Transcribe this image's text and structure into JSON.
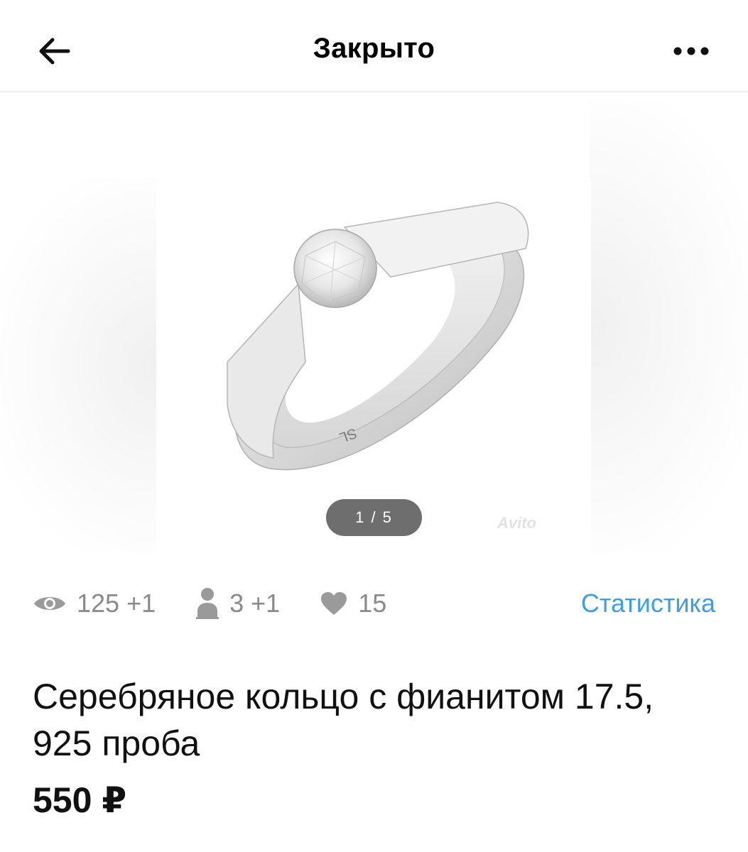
{
  "header": {
    "title": "Закрыто"
  },
  "gallery": {
    "counter": "1 / 5",
    "watermark": "Avito",
    "ring_marking": "SL"
  },
  "stats": {
    "views": "125 +1",
    "contacts": "3 +1",
    "favorites": "15",
    "link": "Статистика"
  },
  "listing": {
    "title": "Серебряное кольцо с фианитом 17.5, 925 проба",
    "price": "550 ₽"
  },
  "colors": {
    "accent": "#3d9ee8",
    "muted": "#8a8a8a",
    "counter_bg": "#6e6e6e"
  },
  "icons": {
    "back": "arrow-left-icon",
    "more": "more-horizontal-icon",
    "views": "eye-icon",
    "contacts": "person-icon",
    "favorites": "heart-icon"
  }
}
